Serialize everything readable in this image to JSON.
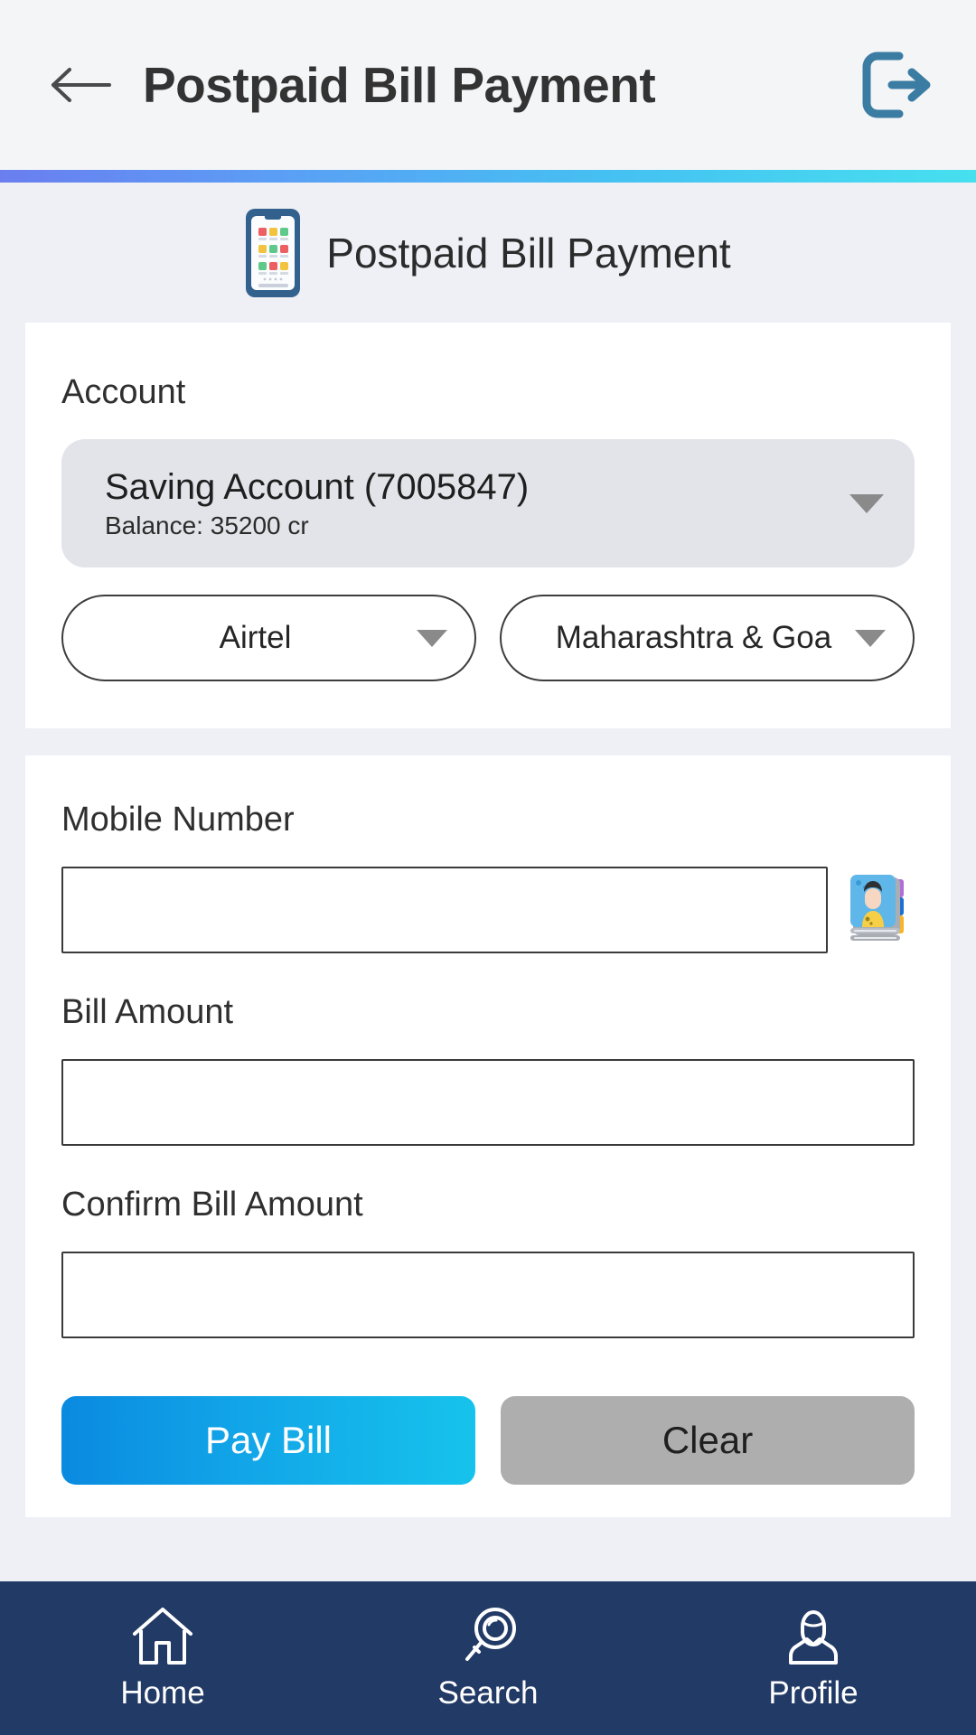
{
  "appbar": {
    "title": "Postpaid Bill Payment",
    "back_icon": "arrow-left-icon",
    "logout_icon": "logout-icon"
  },
  "hero": {
    "title": "Postpaid Bill Payment",
    "icon": "smartphone-icon"
  },
  "account_section": {
    "label": "Account",
    "selected_account": "Saving Account (7005847)",
    "balance": "Balance: 35200 cr",
    "operator": "Airtel",
    "circle": "Maharashtra & Goa"
  },
  "form": {
    "mobile_label": "Mobile Number",
    "mobile_value": "",
    "mobile_placeholder": "",
    "contact_icon": "contact-book-icon",
    "bill_amount_label": "Bill Amount",
    "bill_amount_value": "",
    "bill_amount_placeholder": "",
    "confirm_bill_amount_label": "Confirm Bill Amount",
    "confirm_bill_amount_value": "",
    "confirm_bill_amount_placeholder": "",
    "pay_label": "Pay Bill",
    "clear_label": "Clear"
  },
  "bottom_nav": [
    {
      "label": "Home",
      "icon": "home-icon"
    },
    {
      "label": "Search",
      "icon": "search-icon"
    },
    {
      "label": "Profile",
      "icon": "profile-icon"
    }
  ],
  "colors": {
    "accent_blue": "#12a6e8",
    "nav_background": "#223a66",
    "logout_icon": "#3b7ca3",
    "gradient_start": "#6a7ef0",
    "gradient_end": "#46e0ef"
  }
}
